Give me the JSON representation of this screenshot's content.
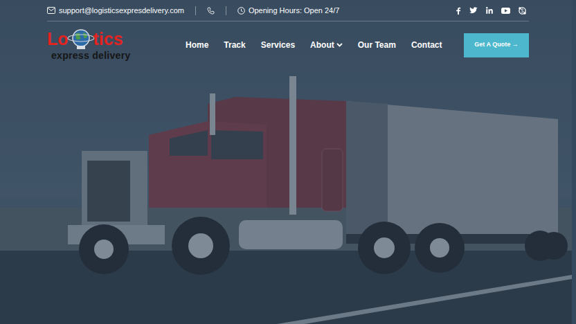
{
  "topbar": {
    "email": "support@logisticsexpresdelivery.com",
    "hours": "Opening Hours: Open 24/7"
  },
  "logo": {
    "word_start": "Lo",
    "word_end": "tics",
    "tagline": "express delivery"
  },
  "nav": [
    {
      "label": "Home",
      "dropdown": false
    },
    {
      "label": "Track",
      "dropdown": false
    },
    {
      "label": "Services",
      "dropdown": false
    },
    {
      "label": "About",
      "dropdown": true
    },
    {
      "label": "Our Team",
      "dropdown": false
    },
    {
      "label": "Contact",
      "dropdown": false
    }
  ],
  "quote_button": "Get A Quote →"
}
